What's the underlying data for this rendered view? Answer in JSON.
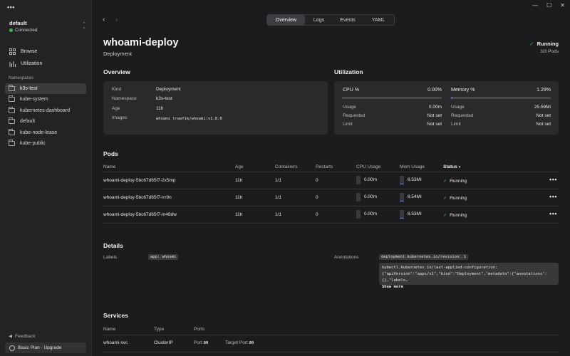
{
  "window": {
    "minimize": "—",
    "maximize": "☐",
    "close": "✕"
  },
  "sidebar": {
    "menu": "•••",
    "cluster": {
      "name": "default",
      "status": "Connected",
      "status_color": "#3fb950"
    },
    "nav": [
      {
        "label": "Browse",
        "icon": "grid-icon"
      },
      {
        "label": "Utilization",
        "icon": "bar-chart-icon"
      }
    ],
    "namespaces_heading": "Namespaces",
    "namespaces": [
      {
        "label": "k3s-test",
        "active": true
      },
      {
        "label": "kube-system"
      },
      {
        "label": "kubernetes-dashboard"
      },
      {
        "label": "default"
      },
      {
        "label": "kube-node-lease"
      },
      {
        "label": "kube-public"
      }
    ],
    "feedback": "Feedback",
    "plan": "Basic Plan · Upgrade"
  },
  "topbar": {
    "back": "‹",
    "forward": "›",
    "tabs": [
      "Overview",
      "Logs",
      "Events",
      "YAML"
    ],
    "active_tab": "Overview"
  },
  "header": {
    "title": "whoami-deploy",
    "kind": "Deployment",
    "status": "Running",
    "pods": "3/3 Pods"
  },
  "overview": {
    "title": "Overview",
    "rows": [
      {
        "key": "Kind",
        "value": "Deployment"
      },
      {
        "key": "Namespace",
        "value": "k3s-test"
      },
      {
        "key": "Age",
        "value": "11h"
      },
      {
        "key": "Images",
        "value": "whoami traefik/whoami:v1.8.0"
      }
    ]
  },
  "utilization": {
    "title": "Utilization",
    "cpu": {
      "label": "CPU %",
      "percent": "0.00%",
      "fraction": 0.0,
      "usage_label": "Usage",
      "usage": "0.00m",
      "requested_label": "Requested",
      "requested": "Not set",
      "limit_label": "Limit",
      "limit": "Not set"
    },
    "memory": {
      "label": "Memory %",
      "percent": "1.29%",
      "fraction": 0.0129,
      "usage_label": "Usage",
      "usage": "25.59Mi",
      "requested_label": "Requested",
      "requested": "Not set",
      "limit_label": "Limit",
      "limit": "Not set"
    }
  },
  "pods": {
    "title": "Pods",
    "columns": {
      "name": "Name",
      "age": "Age",
      "containers": "Containers",
      "restarts": "Restarts",
      "cpu": "CPU Usage",
      "mem": "Mem Usage",
      "status": "Status",
      "sort_indicator": "▾"
    },
    "rows": [
      {
        "name": "whoami-deploy-5bc67d65f7-2x5mp",
        "age": "11h",
        "containers": "1/1",
        "restarts": "0",
        "cpu": "0.00m",
        "mem": "8.53Mi",
        "mem_fraction": 0.08,
        "status": "Running"
      },
      {
        "name": "whoami-deploy-5bc67d65f7-rrr9n",
        "age": "11h",
        "containers": "1/1",
        "restarts": "0",
        "cpu": "0.00m",
        "mem": "8.54Mi",
        "mem_fraction": 0.08,
        "status": "Running"
      },
      {
        "name": "whoami-deploy-5bc67d65f7-m48dw",
        "age": "11h",
        "containers": "1/1",
        "restarts": "0",
        "cpu": "0.00m",
        "mem": "8.53Mi",
        "mem_fraction": 0.08,
        "status": "Running"
      }
    ],
    "row_menu": "•••"
  },
  "details": {
    "title": "Details",
    "labels_key": "Labels",
    "labels_value": "app: whoami",
    "annotations_key": "Annotations",
    "annotation_1": "deployment.kubernetes.io/revision: 1",
    "annotation_2": "kubectl.kubernetes.io/last-applied-configuration: {\"apiVersion\":\"apps/v1\",\"kind\":\"Deployment\",\"metadata\":{\"annotations\":{},\"labels…",
    "show_more": "Show more"
  },
  "services": {
    "title": "Services",
    "columns": {
      "name": "Name",
      "type": "Type",
      "ports": "Ports"
    },
    "rows": [
      {
        "name": "whoami-svc",
        "type": "ClusterIP",
        "port_label": "Port",
        "port": "80",
        "target_label": "Target Port",
        "target": "80"
      }
    ]
  }
}
